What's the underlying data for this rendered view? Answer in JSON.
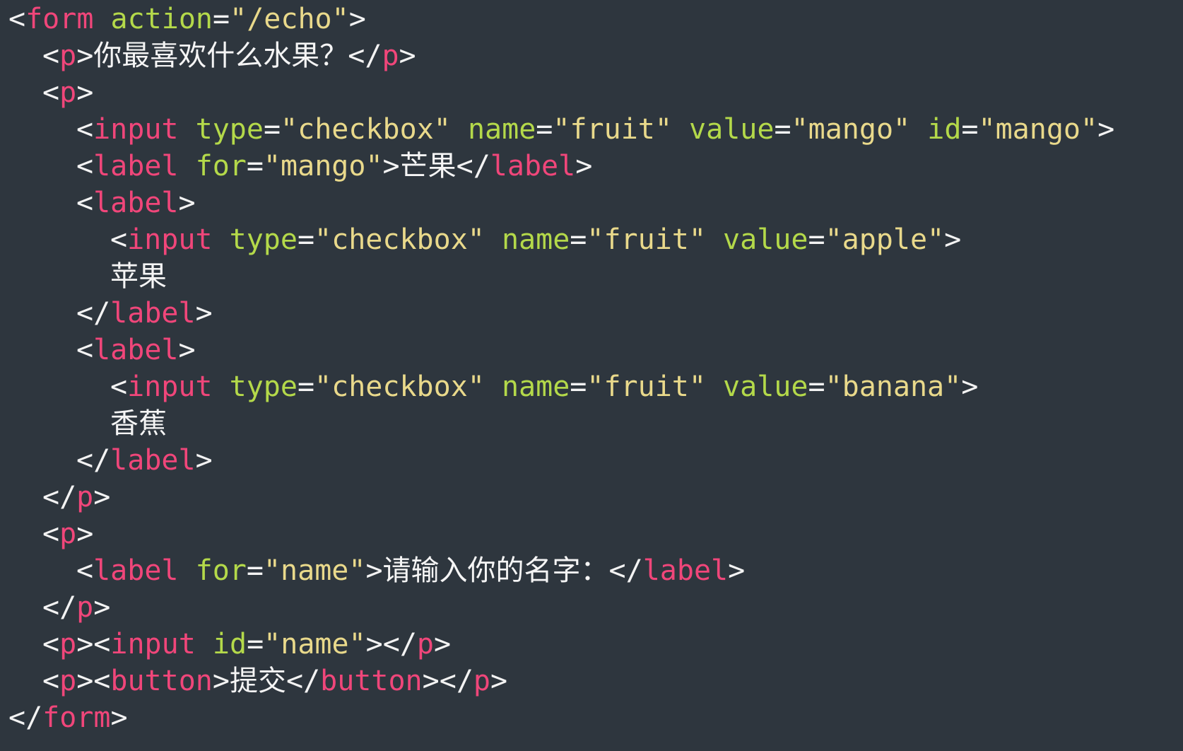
{
  "colors": {
    "background": "#2e363e",
    "punctuation": "#f3f3f3",
    "tag": "#f0467a",
    "attribute": "#b4d94a",
    "string": "#e9d98b",
    "text": "#f5f5f5"
  },
  "code": {
    "lines": [
      {
        "indent": 0,
        "tokens": [
          {
            "t": "punct",
            "v": "<"
          },
          {
            "t": "tag",
            "v": "form"
          },
          {
            "t": "punct",
            "v": " "
          },
          {
            "t": "attr",
            "v": "action"
          },
          {
            "t": "punct",
            "v": "="
          },
          {
            "t": "str",
            "v": "\"/echo\""
          },
          {
            "t": "punct",
            "v": ">"
          }
        ]
      },
      {
        "indent": 1,
        "tokens": [
          {
            "t": "punct",
            "v": "<"
          },
          {
            "t": "tag",
            "v": "p"
          },
          {
            "t": "punct",
            "v": ">"
          },
          {
            "t": "text",
            "v": "你最喜欢什么水果？"
          },
          {
            "t": "punct",
            "v": "</"
          },
          {
            "t": "tag",
            "v": "p"
          },
          {
            "t": "punct",
            "v": ">"
          }
        ]
      },
      {
        "indent": 1,
        "tokens": [
          {
            "t": "punct",
            "v": "<"
          },
          {
            "t": "tag",
            "v": "p"
          },
          {
            "t": "punct",
            "v": ">"
          }
        ]
      },
      {
        "indent": 2,
        "tokens": [
          {
            "t": "punct",
            "v": "<"
          },
          {
            "t": "tag",
            "v": "input"
          },
          {
            "t": "punct",
            "v": " "
          },
          {
            "t": "attr",
            "v": "type"
          },
          {
            "t": "punct",
            "v": "="
          },
          {
            "t": "str",
            "v": "\"checkbox\""
          },
          {
            "t": "punct",
            "v": " "
          },
          {
            "t": "attr",
            "v": "name"
          },
          {
            "t": "punct",
            "v": "="
          },
          {
            "t": "str",
            "v": "\"fruit\""
          },
          {
            "t": "punct",
            "v": " "
          },
          {
            "t": "attr",
            "v": "value"
          },
          {
            "t": "punct",
            "v": "="
          },
          {
            "t": "str",
            "v": "\"mango\""
          },
          {
            "t": "punct",
            "v": " "
          },
          {
            "t": "attr",
            "v": "id"
          },
          {
            "t": "punct",
            "v": "="
          },
          {
            "t": "str",
            "v": "\"mango\""
          },
          {
            "t": "punct",
            "v": ">"
          }
        ]
      },
      {
        "indent": 2,
        "tokens": [
          {
            "t": "punct",
            "v": "<"
          },
          {
            "t": "tag",
            "v": "label"
          },
          {
            "t": "punct",
            "v": " "
          },
          {
            "t": "attr",
            "v": "for"
          },
          {
            "t": "punct",
            "v": "="
          },
          {
            "t": "str",
            "v": "\"mango\""
          },
          {
            "t": "punct",
            "v": ">"
          },
          {
            "t": "text",
            "v": "芒果"
          },
          {
            "t": "punct",
            "v": "</"
          },
          {
            "t": "tag",
            "v": "label"
          },
          {
            "t": "punct",
            "v": ">"
          }
        ]
      },
      {
        "indent": 2,
        "tokens": [
          {
            "t": "punct",
            "v": "<"
          },
          {
            "t": "tag",
            "v": "label"
          },
          {
            "t": "punct",
            "v": ">"
          }
        ]
      },
      {
        "indent": 3,
        "tokens": [
          {
            "t": "punct",
            "v": "<"
          },
          {
            "t": "tag",
            "v": "input"
          },
          {
            "t": "punct",
            "v": " "
          },
          {
            "t": "attr",
            "v": "type"
          },
          {
            "t": "punct",
            "v": "="
          },
          {
            "t": "str",
            "v": "\"checkbox\""
          },
          {
            "t": "punct",
            "v": " "
          },
          {
            "t": "attr",
            "v": "name"
          },
          {
            "t": "punct",
            "v": "="
          },
          {
            "t": "str",
            "v": "\"fruit\""
          },
          {
            "t": "punct",
            "v": " "
          },
          {
            "t": "attr",
            "v": "value"
          },
          {
            "t": "punct",
            "v": "="
          },
          {
            "t": "str",
            "v": "\"apple\""
          },
          {
            "t": "punct",
            "v": ">"
          }
        ]
      },
      {
        "indent": 3,
        "tokens": [
          {
            "t": "text",
            "v": "苹果"
          }
        ]
      },
      {
        "indent": 2,
        "tokens": [
          {
            "t": "punct",
            "v": "</"
          },
          {
            "t": "tag",
            "v": "label"
          },
          {
            "t": "punct",
            "v": ">"
          }
        ]
      },
      {
        "indent": 2,
        "tokens": [
          {
            "t": "punct",
            "v": "<"
          },
          {
            "t": "tag",
            "v": "label"
          },
          {
            "t": "punct",
            "v": ">"
          }
        ]
      },
      {
        "indent": 3,
        "tokens": [
          {
            "t": "punct",
            "v": "<"
          },
          {
            "t": "tag",
            "v": "input"
          },
          {
            "t": "punct",
            "v": " "
          },
          {
            "t": "attr",
            "v": "type"
          },
          {
            "t": "punct",
            "v": "="
          },
          {
            "t": "str",
            "v": "\"checkbox\""
          },
          {
            "t": "punct",
            "v": " "
          },
          {
            "t": "attr",
            "v": "name"
          },
          {
            "t": "punct",
            "v": "="
          },
          {
            "t": "str",
            "v": "\"fruit\""
          },
          {
            "t": "punct",
            "v": " "
          },
          {
            "t": "attr",
            "v": "value"
          },
          {
            "t": "punct",
            "v": "="
          },
          {
            "t": "str",
            "v": "\"banana\""
          },
          {
            "t": "punct",
            "v": ">"
          }
        ]
      },
      {
        "indent": 3,
        "tokens": [
          {
            "t": "text",
            "v": "香蕉"
          }
        ]
      },
      {
        "indent": 2,
        "tokens": [
          {
            "t": "punct",
            "v": "</"
          },
          {
            "t": "tag",
            "v": "label"
          },
          {
            "t": "punct",
            "v": ">"
          }
        ]
      },
      {
        "indent": 1,
        "tokens": [
          {
            "t": "punct",
            "v": "</"
          },
          {
            "t": "tag",
            "v": "p"
          },
          {
            "t": "punct",
            "v": ">"
          }
        ]
      },
      {
        "indent": 1,
        "tokens": [
          {
            "t": "punct",
            "v": "<"
          },
          {
            "t": "tag",
            "v": "p"
          },
          {
            "t": "punct",
            "v": ">"
          }
        ]
      },
      {
        "indent": 2,
        "tokens": [
          {
            "t": "punct",
            "v": "<"
          },
          {
            "t": "tag",
            "v": "label"
          },
          {
            "t": "punct",
            "v": " "
          },
          {
            "t": "attr",
            "v": "for"
          },
          {
            "t": "punct",
            "v": "="
          },
          {
            "t": "str",
            "v": "\"name\""
          },
          {
            "t": "punct",
            "v": ">"
          },
          {
            "t": "text",
            "v": "请输入你的名字："
          },
          {
            "t": "punct",
            "v": "</"
          },
          {
            "t": "tag",
            "v": "label"
          },
          {
            "t": "punct",
            "v": ">"
          }
        ]
      },
      {
        "indent": 1,
        "tokens": [
          {
            "t": "punct",
            "v": "</"
          },
          {
            "t": "tag",
            "v": "p"
          },
          {
            "t": "punct",
            "v": ">"
          }
        ]
      },
      {
        "indent": 1,
        "tokens": [
          {
            "t": "punct",
            "v": "<"
          },
          {
            "t": "tag",
            "v": "p"
          },
          {
            "t": "punct",
            "v": ">"
          },
          {
            "t": "punct",
            "v": "<"
          },
          {
            "t": "tag",
            "v": "input"
          },
          {
            "t": "punct",
            "v": " "
          },
          {
            "t": "attr",
            "v": "id"
          },
          {
            "t": "punct",
            "v": "="
          },
          {
            "t": "str",
            "v": "\"name\""
          },
          {
            "t": "punct",
            "v": ">"
          },
          {
            "t": "punct",
            "v": "</"
          },
          {
            "t": "tag",
            "v": "p"
          },
          {
            "t": "punct",
            "v": ">"
          }
        ]
      },
      {
        "indent": 1,
        "tokens": [
          {
            "t": "punct",
            "v": "<"
          },
          {
            "t": "tag",
            "v": "p"
          },
          {
            "t": "punct",
            "v": ">"
          },
          {
            "t": "punct",
            "v": "<"
          },
          {
            "t": "tag",
            "v": "button"
          },
          {
            "t": "punct",
            "v": ">"
          },
          {
            "t": "text",
            "v": "提交"
          },
          {
            "t": "punct",
            "v": "</"
          },
          {
            "t": "tag",
            "v": "button"
          },
          {
            "t": "punct",
            "v": ">"
          },
          {
            "t": "punct",
            "v": "</"
          },
          {
            "t": "tag",
            "v": "p"
          },
          {
            "t": "punct",
            "v": ">"
          }
        ]
      },
      {
        "indent": 0,
        "tokens": [
          {
            "t": "punct",
            "v": "</"
          },
          {
            "t": "tag",
            "v": "form"
          },
          {
            "t": "punct",
            "v": ">"
          }
        ]
      }
    ]
  }
}
